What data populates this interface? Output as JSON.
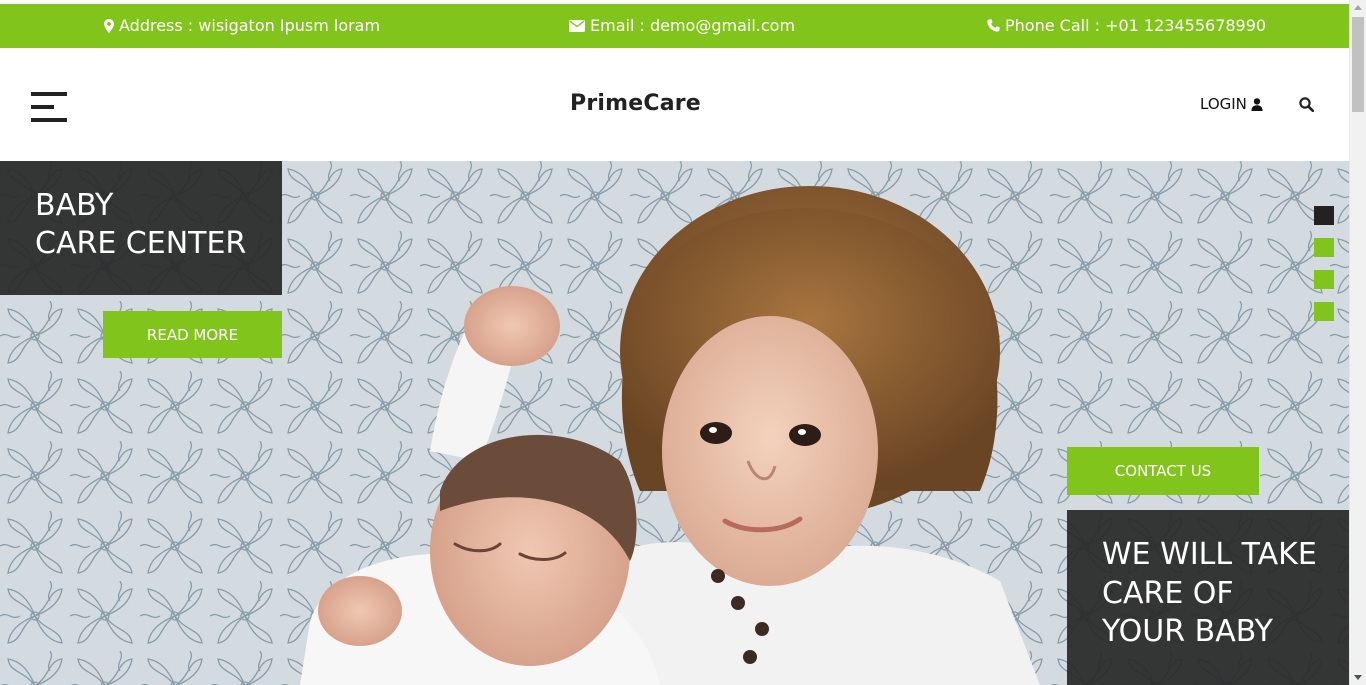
{
  "topbar": {
    "address": "Address : wisigaton Ipusm loram",
    "email": "Email : demo@gmail.com",
    "phone": "Phone Call : +01 123455678990",
    "address_icon": "map-marker-icon",
    "email_icon": "envelope-icon",
    "phone_icon": "phone-icon"
  },
  "header": {
    "brand": "PrimeCare",
    "login_label": "LOGIN",
    "login_icon": "user-icon",
    "search_icon": "search-icon",
    "menu_icon": "hamburger-menu-icon"
  },
  "hero": {
    "title_line1": "BABY",
    "title_line2": "CARE CENTER",
    "read_more_label": "READ MORE",
    "contact_label": "CONTACT US",
    "tagline_line1": "WE WILL TAKE",
    "tagline_line2": "CARE OF",
    "tagline_line3": "YOUR BABY",
    "image_subject": "two children lying on floral bedding",
    "slider_count": 4,
    "slider_active_index": 0
  },
  "colors": {
    "accent": "#80c41c",
    "dark_panel": "#282828",
    "text_dark": "#222222"
  }
}
